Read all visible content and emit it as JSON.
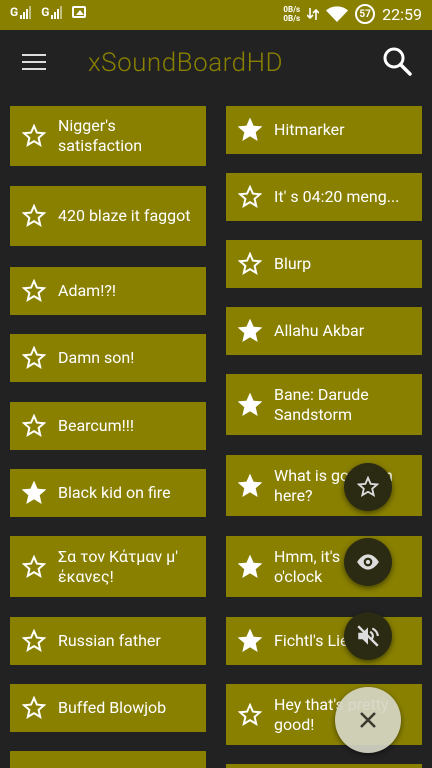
{
  "status_bar": {
    "sim1": "G",
    "sim2": "G",
    "netspeed_up": "0B/s",
    "netspeed_down": "0B/s",
    "battery": "57",
    "time": "22:59"
  },
  "toolbar": {
    "title": "xSoundBoardHD",
    "menu_icon": "hamburger-menu-icon",
    "search_icon": "search-icon"
  },
  "sounds": {
    "left": [
      {
        "label": "Nigger's satisfaction",
        "favorite": false
      },
      {
        "label": "420 blaze it faggot",
        "favorite": false
      },
      {
        "label": "Adam!?!",
        "favorite": false
      },
      {
        "label": "Damn son!",
        "favorite": false
      },
      {
        "label": "Bearcum!!!",
        "favorite": false
      },
      {
        "label": "Black kid on fire",
        "favorite": true
      },
      {
        "label": "Σα τον Κάτμαν μ' έκανες!",
        "favorite": false
      },
      {
        "label": "Russian father",
        "favorite": false
      },
      {
        "label": "Buffed Blowjob",
        "favorite": false
      }
    ],
    "right": [
      {
        "label": "Hitmarker",
        "favorite": true
      },
      {
        "label": "It' s 04:20 meng...",
        "favorite": false
      },
      {
        "label": "Blurp",
        "favorite": false
      },
      {
        "label": "Allahu Akbar",
        "favorite": true
      },
      {
        "label": "Bane: Darude Sandstorm",
        "favorite": true
      },
      {
        "label": "What is going on here?",
        "favorite": true
      },
      {
        "label": "Hmm, it's d... o'clock",
        "favorite": true
      },
      {
        "label": "Fichtl's Lied",
        "favorite": true
      },
      {
        "label": "Hey that's pretty good!",
        "favorite": false
      }
    ]
  },
  "fabs": {
    "favorites_icon": "star-outline-icon",
    "visibility_icon": "eye-icon",
    "mute_icon": "volume-off-icon",
    "close_icon": "close-icon"
  },
  "colors": {
    "accent": "#898000",
    "background": "#222222"
  }
}
